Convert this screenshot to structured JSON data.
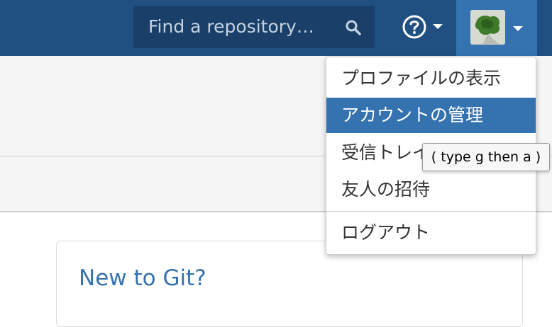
{
  "header": {
    "search": {
      "placeholder": "Find a repository…",
      "icon": "search-icon"
    },
    "help": {
      "icon": "help-circle-icon"
    },
    "user": {
      "icon": "avatar"
    }
  },
  "user_menu": {
    "items": [
      "プロファイルの表示",
      "アカウントの管理",
      "受信トレイ",
      "友人の招待",
      "ログアウト"
    ],
    "active_index": 1
  },
  "tooltip": "( type g then a )",
  "card": {
    "title": "New to Git?"
  },
  "colors": {
    "topbar": "#205081",
    "accent": "#3572b0",
    "search_bg": "#1a3f68",
    "link": "#3572b0"
  }
}
